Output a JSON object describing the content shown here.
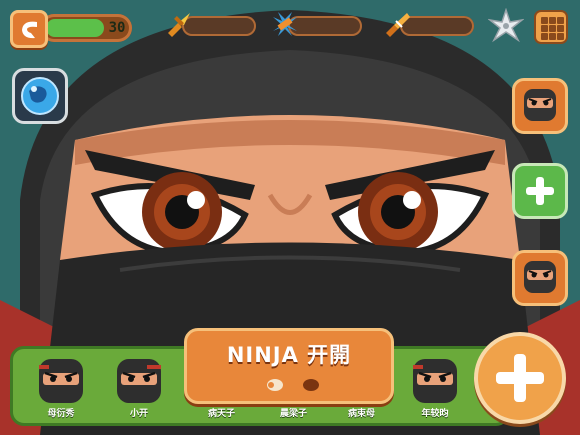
{
  "hud": {
    "xp_value": "30",
    "xp_progress": 0.72
  },
  "resources": [
    {
      "icon": "gold-kunai-icon",
      "fill": 0.0,
      "color": "#f0b030"
    },
    {
      "icon": "blue-shuriken-cross-icon",
      "fill": 0.0,
      "color": "#3a9ad8"
    },
    {
      "icon": "gold-scroll-icon",
      "fill": 0.0,
      "color": "#f0a040"
    }
  ],
  "roster": [
    {
      "label": "母衍秀"
    },
    {
      "label": "小开"
    },
    {
      "label": "年较昀"
    }
  ],
  "center_labels": [
    "病天子",
    "晨梁子",
    "病束母"
  ],
  "main_panel": {
    "title": "NINJA  开開"
  },
  "colors": {
    "accent_orange": "#e8873a",
    "bar_green": "#6aaa3a",
    "xp_green": "#5cc04a"
  }
}
